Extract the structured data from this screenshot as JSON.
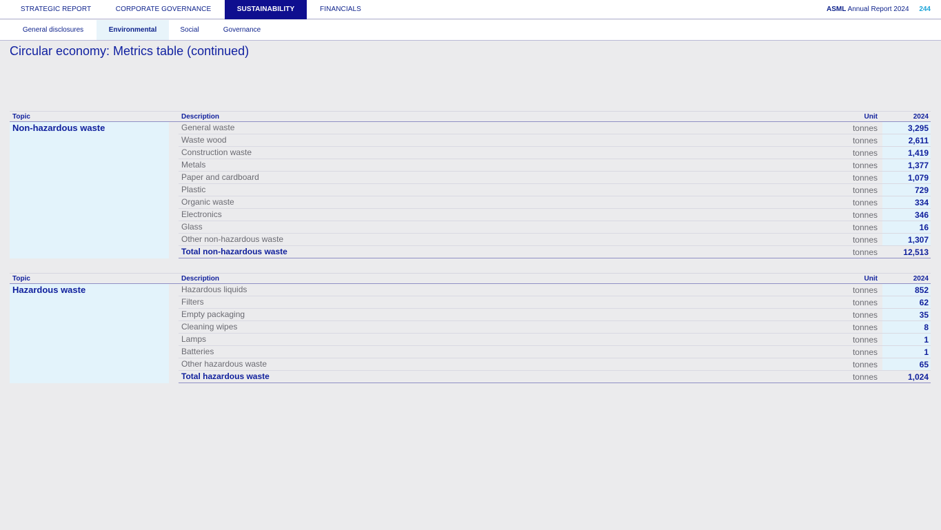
{
  "topnav": {
    "tabs": [
      "STRATEGIC REPORT",
      "CORPORATE GOVERNANCE",
      "SUSTAINABILITY",
      "FINANCIALS"
    ],
    "active_index": 2,
    "brand_strong": "ASML",
    "brand_text": "Annual Report 2024",
    "page_number": "244"
  },
  "subnav": {
    "tabs": [
      "General disclosures",
      "Environmental",
      "Social",
      "Governance"
    ],
    "active_index": 1
  },
  "title": "Circular economy: Metrics table (continued)",
  "tables": [
    {
      "headers": {
        "topic": "Topic",
        "description": "Description",
        "unit": "Unit",
        "year": "2024"
      },
      "topic": "Non-hazardous waste",
      "rows": [
        {
          "desc": "General waste",
          "unit": "tonnes",
          "value": "3,295"
        },
        {
          "desc": "Waste wood",
          "unit": "tonnes",
          "value": "2,611"
        },
        {
          "desc": "Construction waste",
          "unit": "tonnes",
          "value": "1,419"
        },
        {
          "desc": "Metals",
          "unit": "tonnes",
          "value": "1,377"
        },
        {
          "desc": "Paper and cardboard",
          "unit": "tonnes",
          "value": "1,079"
        },
        {
          "desc": "Plastic",
          "unit": "tonnes",
          "value": "729"
        },
        {
          "desc": "Organic waste",
          "unit": "tonnes",
          "value": "334"
        },
        {
          "desc": "Electronics",
          "unit": "tonnes",
          "value": "346"
        },
        {
          "desc": "Glass",
          "unit": "tonnes",
          "value": "16"
        },
        {
          "desc": "Other non-hazardous waste",
          "unit": "tonnes",
          "value": "1,307"
        },
        {
          "desc": "Total non-hazardous waste",
          "unit": "tonnes",
          "value": "12,513",
          "total": true
        }
      ]
    },
    {
      "headers": {
        "topic": "Topic",
        "description": "Description",
        "unit": "Unit",
        "year": "2024"
      },
      "topic": "Hazardous waste",
      "rows": [
        {
          "desc": "Hazardous liquids",
          "unit": "tonnes",
          "value": "852"
        },
        {
          "desc": "Filters",
          "unit": "tonnes",
          "value": "62"
        },
        {
          "desc": "Empty packaging",
          "unit": "tonnes",
          "value": "35"
        },
        {
          "desc": "Cleaning wipes",
          "unit": "tonnes",
          "value": "8"
        },
        {
          "desc": "Lamps",
          "unit": "tonnes",
          "value": "1"
        },
        {
          "desc": "Batteries",
          "unit": "tonnes",
          "value": "1"
        },
        {
          "desc": "Other hazardous waste",
          "unit": "tonnes",
          "value": "65"
        },
        {
          "desc": "Total hazardous waste",
          "unit": "tonnes",
          "value": "1,024",
          "total": true
        }
      ]
    }
  ],
  "colors": {
    "brand_blue": "#0f238c",
    "active_tab": "#0f0f8f",
    "highlight_cell": "#e3f3fb",
    "page_number": "#1ea5d8",
    "background": "#ebebed"
  }
}
